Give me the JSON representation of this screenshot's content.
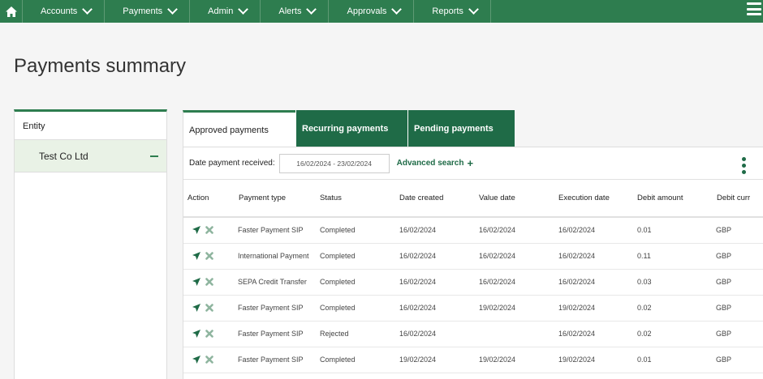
{
  "nav": {
    "items": [
      {
        "label": "Accounts"
      },
      {
        "label": "Payments"
      },
      {
        "label": "Admin"
      },
      {
        "label": "Alerts"
      },
      {
        "label": "Approvals"
      },
      {
        "label": "Reports"
      }
    ]
  },
  "page": {
    "title": "Payments summary"
  },
  "entity_panel": {
    "header": "Entity",
    "selected": "Test Co Ltd"
  },
  "tabs": [
    {
      "label": "Approved payments"
    },
    {
      "label": "Recurring payments"
    },
    {
      "label": "Pending payments"
    }
  ],
  "filter": {
    "label": "Date payment received:",
    "date_range": "16/02/2024 - 23/02/2024",
    "advanced_search": "Advanced search",
    "advanced_search_icon": "+"
  },
  "table": {
    "columns": [
      "Action",
      "Payment type",
      "Status",
      "Date created",
      "Value date",
      "Execution date",
      "Debit amount",
      "Debit curr"
    ],
    "rows": [
      {
        "payment_type": "Faster Payment SIP",
        "status": "Completed",
        "date_created": "16/02/2024",
        "value_date": "16/02/2024",
        "execution_date": "16/02/2024",
        "debit_amount": "0.01",
        "debit_currency": "GBP"
      },
      {
        "payment_type": "International Payment",
        "status": "Completed",
        "date_created": "16/02/2024",
        "value_date": "16/02/2024",
        "execution_date": "16/02/2024",
        "debit_amount": "0.11",
        "debit_currency": "GBP"
      },
      {
        "payment_type": "SEPA Credit Transfer",
        "status": "Completed",
        "date_created": "16/02/2024",
        "value_date": "16/02/2024",
        "execution_date": "16/02/2024",
        "debit_amount": "0.03",
        "debit_currency": "GBP"
      },
      {
        "payment_type": "Faster Payment SIP",
        "status": "Completed",
        "date_created": "16/02/2024",
        "value_date": "19/02/2024",
        "execution_date": "19/02/2024",
        "debit_amount": "0.02",
        "debit_currency": "GBP"
      },
      {
        "payment_type": "Faster Payment SIP",
        "status": "Rejected",
        "date_created": "16/02/2024",
        "value_date": "",
        "execution_date": "16/02/2024",
        "debit_amount": "0.02",
        "debit_currency": "GBP"
      },
      {
        "payment_type": "Faster Payment SIP",
        "status": "Completed",
        "date_created": "19/02/2024",
        "value_date": "19/02/2024",
        "execution_date": "19/02/2024",
        "debit_amount": "0.01",
        "debit_currency": "GBP"
      }
    ]
  },
  "colors": {
    "brand_green": "#2e7d4f",
    "tab_green": "#1f6b47",
    "entity_selected_bg": "#e9f2e6"
  },
  "icons": {
    "home": "home-icon",
    "nav_dropdown": "chevron-down-icon",
    "menu": "hamburger-menu-icon",
    "collapse": "minus-icon",
    "more": "kebab-menu-icon",
    "row_send": "send-arrow-icon",
    "row_cancel": "close-icon"
  }
}
